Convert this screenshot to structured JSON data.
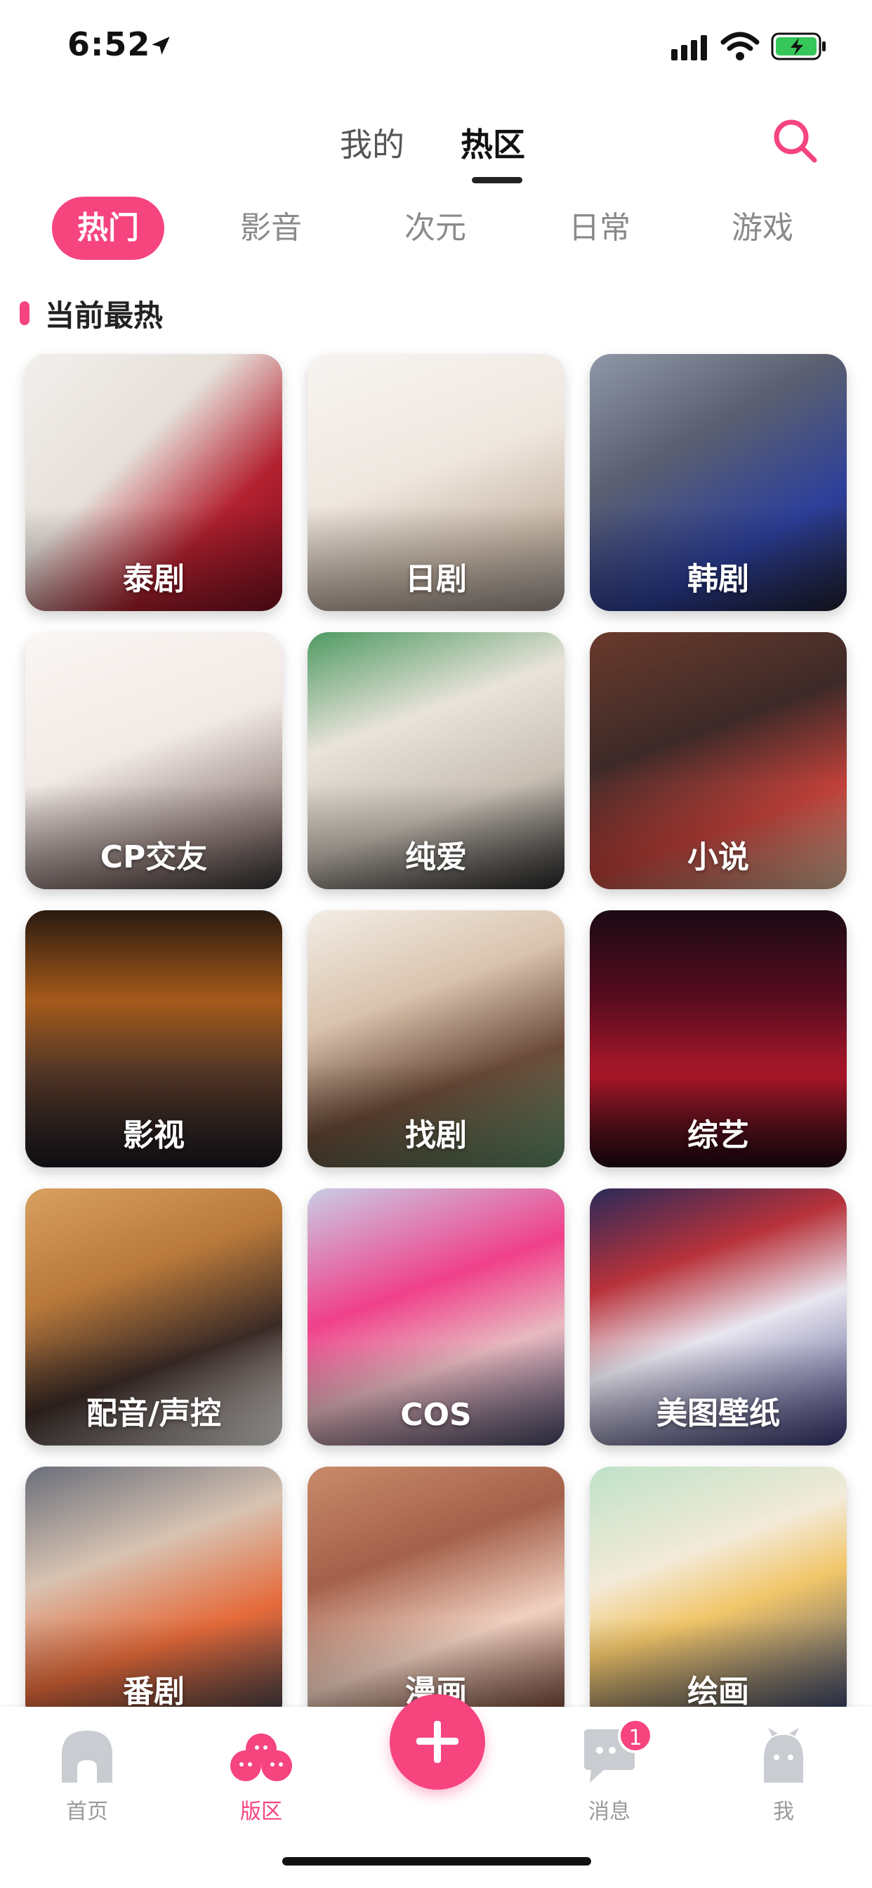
{
  "status_bar": {
    "time": "6:52"
  },
  "header": {
    "tabs": [
      {
        "label": "我的"
      },
      {
        "label": "热区"
      }
    ],
    "active_tab": "热区"
  },
  "categories": [
    {
      "label": "热门",
      "active": true
    },
    {
      "label": "影音"
    },
    {
      "label": "次元"
    },
    {
      "label": "日常"
    },
    {
      "label": "游戏"
    }
  ],
  "section": {
    "title": "当前最热"
  },
  "cards": [
    {
      "label": "泰剧"
    },
    {
      "label": "日剧"
    },
    {
      "label": "韩剧"
    },
    {
      "label": "CP交友"
    },
    {
      "label": "纯爱"
    },
    {
      "label": "小说"
    },
    {
      "label": "影视"
    },
    {
      "label": "找剧"
    },
    {
      "label": "综艺"
    },
    {
      "label": "配音/声控"
    },
    {
      "label": "COS"
    },
    {
      "label": "美图壁纸"
    },
    {
      "label": "番剧"
    },
    {
      "label": "漫画"
    },
    {
      "label": "绘画"
    }
  ],
  "bottom_nav": {
    "items": [
      {
        "label": "首页"
      },
      {
        "label": "版区"
      },
      {
        "label": "消息",
        "badge": "1"
      },
      {
        "label": "我"
      }
    ],
    "active": "版区"
  },
  "colors": {
    "accent": "#f5447e",
    "text": "#222222",
    "muted": "#8a8a8a"
  }
}
